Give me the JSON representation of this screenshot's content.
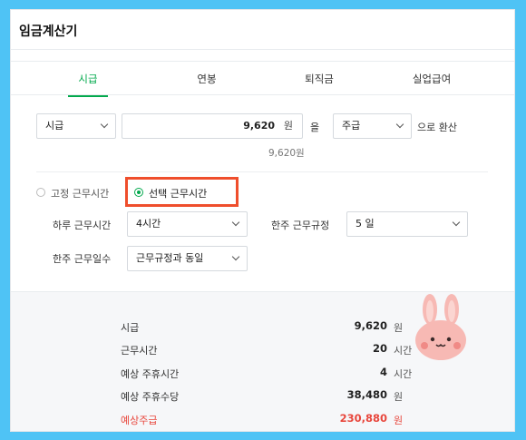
{
  "title": "임금계산기",
  "tabs": [
    {
      "label": "시급",
      "active": true
    },
    {
      "label": "연봉",
      "active": false
    },
    {
      "label": "퇴직금",
      "active": false
    },
    {
      "label": "실업급여",
      "active": false
    }
  ],
  "convert": {
    "unit_select": "시급",
    "amount": "9,620",
    "amount_unit": "원",
    "particle": "을",
    "target_select": "주급",
    "suffix": "으로 환산",
    "amount_hint": "9,620원"
  },
  "mode": {
    "fixed_label": "고정 근무시간",
    "selected_label": "선택 근무시간",
    "selected": "selected"
  },
  "fields": {
    "daily_hours_label": "하루 근무시간",
    "daily_hours_value": "4시간",
    "weekly_rule_label": "한주 근무규정",
    "weekly_rule_value": "5 일",
    "weekly_days_label": "한주 근무일수",
    "weekly_days_value": "근무규정과 동일"
  },
  "results": [
    {
      "label": "시급",
      "value": "9,620",
      "unit": "원",
      "highlight": false
    },
    {
      "label": "근무시간",
      "value": "20",
      "unit": "시간",
      "highlight": false
    },
    {
      "label": "예상 주휴시간",
      "value": "4",
      "unit": "시간",
      "highlight": false
    },
    {
      "label": "예상 주휴수당",
      "value": "38,480",
      "unit": "원",
      "highlight": false
    },
    {
      "label": "예상주급",
      "value": "230,880",
      "unit": "원",
      "highlight": true
    }
  ],
  "colors": {
    "accent": "#03a94d",
    "highlight_box": "#ef4e2c",
    "result_emphasis": "#e8473d",
    "frame": "#4fc3f5"
  }
}
